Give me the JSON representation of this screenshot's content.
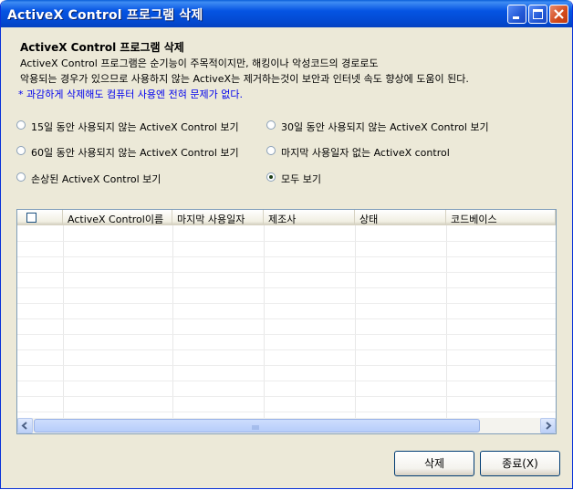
{
  "window": {
    "title": "ActiveX Control 프로그램 삭제"
  },
  "header": {
    "title": "ActiveX Control 프로그램 삭제",
    "description_line1": "ActiveX Control 프로그램은 순기능이 주목적이지만, 해킹이나 악성코드의 경로로도",
    "description_line2": "악용되는 경우가 있으므로 사용하지 않는 ActiveX는 제거하는것이 보안과 인터넷 속도 향상에 도움이 된다.",
    "note": "* 과감하게 삭제해도 컴퓨터 사용엔 전혀 문제가 없다."
  },
  "filters": [
    {
      "label": "15일 동안 사용되지 않는 ActiveX Control 보기",
      "selected": false
    },
    {
      "label": "30일 동안 사용되지 않는 ActiveX Control 보기",
      "selected": false
    },
    {
      "label": "60일 동안 사용되지 않는 ActiveX Control 보기",
      "selected": false
    },
    {
      "label": "마지막 사용일자 없는 ActiveX control",
      "selected": false
    },
    {
      "label": "손상된 ActiveX Control 보기",
      "selected": false
    },
    {
      "label": "모두 보기",
      "selected": true
    }
  ],
  "list": {
    "columns": [
      "ActiveX Control이름",
      "마지막 사용일자",
      "제조사",
      "상태",
      "코드베이스"
    ],
    "rows": []
  },
  "buttons": {
    "delete_label": "삭제",
    "close_label": "종료(X)"
  }
}
